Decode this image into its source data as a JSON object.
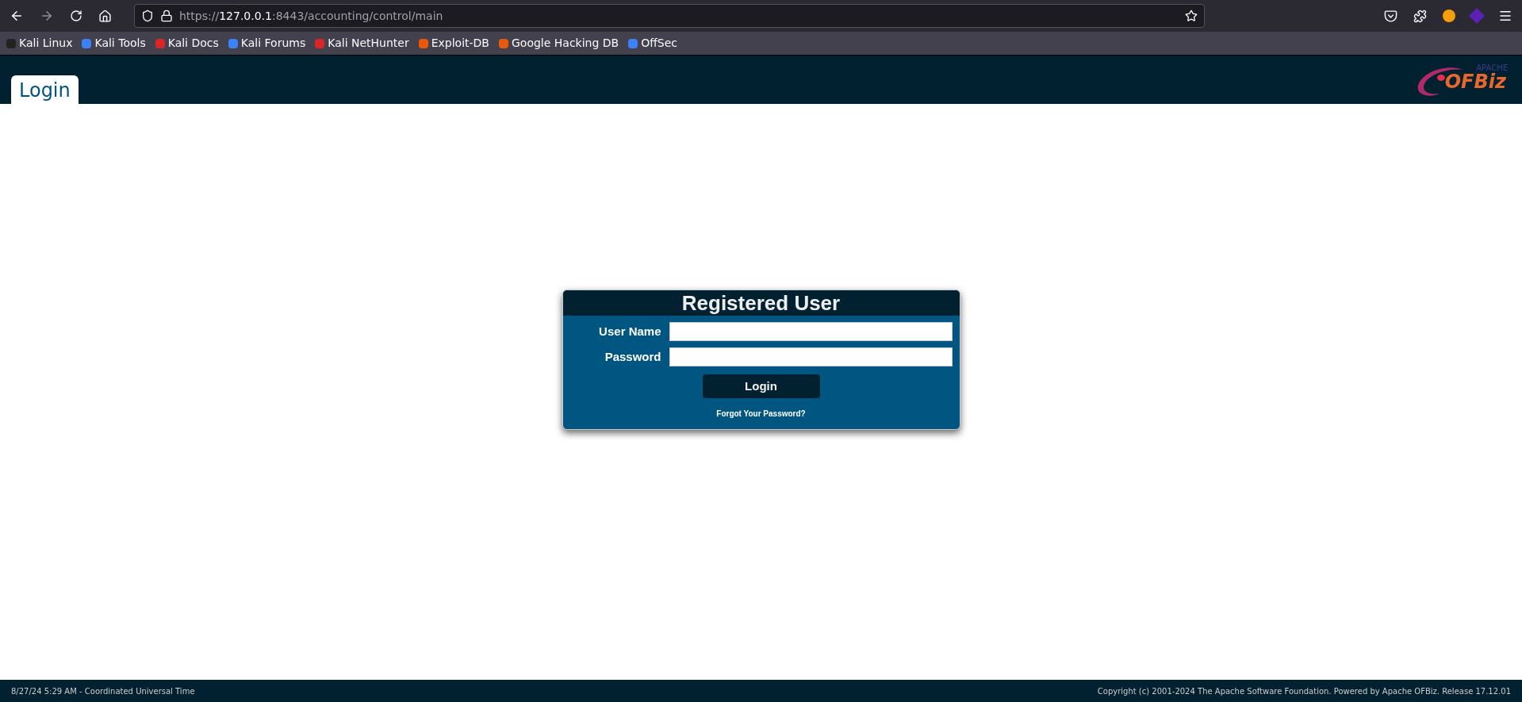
{
  "browser": {
    "url": {
      "scheme": "https://",
      "host": "127.0.0.1",
      "path": ":8443/accounting/control/main"
    },
    "bookmarks": [
      "Kali Linux",
      "Kali Tools",
      "Kali Docs",
      "Kali Forums",
      "Kali NetHunter",
      "Exploit-DB",
      "Google Hacking DB",
      "OffSec"
    ]
  },
  "header": {
    "tabs": [
      {
        "label": "Login",
        "selected": true
      }
    ],
    "logo": {
      "top": "APACHE",
      "main": "OFBiz"
    }
  },
  "login": {
    "title": "Registered User",
    "fields": [
      {
        "label": "User Name"
      },
      {
        "label": "Password"
      }
    ],
    "button": "Login",
    "forgot": "Forgot Your Password?"
  },
  "footer": {
    "left": "8/27/24 5:29 AM - Coordinated Universal Time",
    "right": "Copyright (c) 2001-2024 The Apache Software Foundation. Powered by Apache OFBiz. Release 17.12.01"
  }
}
